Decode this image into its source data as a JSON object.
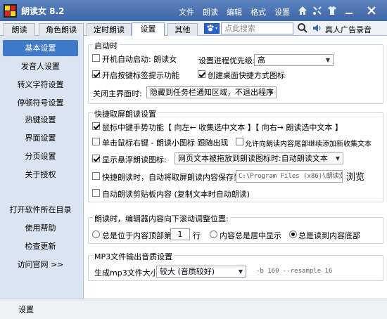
{
  "titlebar": {
    "title": "朗读女 8.2",
    "menu": [
      "文件",
      "朗读",
      "编辑",
      "格式",
      "设置"
    ],
    "icons": [
      "home-icon",
      "settings-gear-icon",
      "shirt-icon",
      "minimize-icon",
      "close-icon"
    ],
    "colors": {
      "bar": "#4a73b3",
      "logo_yellow": "#f7d21a",
      "logo_red": "#d8231f"
    }
  },
  "tabs": {
    "items": [
      "朗读",
      "角色朗读",
      "定时朗读",
      "设置",
      "其他"
    ],
    "active": "设置"
  },
  "search": {
    "placeholder": "点此搜索"
  },
  "ad_link": "真人广告录音",
  "sidebar": {
    "items": [
      "基本设置",
      "发音人设置",
      "转义字符设置",
      "停顿符号设置",
      "热键设置",
      "界面设置",
      "分页设置",
      "关于授权"
    ],
    "active": "基本设置",
    "links": [
      "打开软件所在目录",
      "使用帮助",
      "检查更新",
      "访问官网 >>"
    ]
  },
  "startup": {
    "title": "启动时",
    "auto_start_label": "开机自动启动: 朗读女",
    "auto_start_checked": false,
    "priority_label": "设置进程优先级:",
    "priority_value": "高",
    "hotkey_label": "开启按键标签提示功能",
    "hotkey_checked": true,
    "shortcut_label": "创建桌面快捷方式图标",
    "shortcut_checked": true,
    "close_label": "关闭主界面时:",
    "close_value": "隐藏到任务栏通知区域，不退出程序"
  },
  "screen_read": {
    "title": "快捷取屏朗读设置",
    "gesture_label": "鼠标中键手势功能【 向左← 收集选中文本 】【 向右→ 朗读选中文本 】",
    "gesture_checked": true,
    "rightclick_label": "单击鼠标右键 - 朗读小图标 跟随出现",
    "rightclick_checked": false,
    "append_label": "允许向朗读内容尾部继续添加新收集文本",
    "append_checked": false,
    "float_label": "显示悬浮朗读图标:",
    "float_checked": true,
    "float_value": "网页文本被拖放到朗读图标时:自动朗读文本",
    "quick_save_label": "快捷朗读时，自动将取屏朗读内容保存到:",
    "quick_save_checked": false,
    "quick_save_path": "C:\\Program Files (x86)\\朗读女\\",
    "browse_label": "浏览",
    "clipboard_label": "自动朗读剪贴板内容 (复制文本时自动朗读)",
    "clipboard_checked": false
  },
  "scroll": {
    "title": "朗读时，编辑器内容向下滚动调整位置:",
    "opt_top_prefix": "总是位于内容顶部第",
    "opt_top_value": "1",
    "opt_top_suffix": "行",
    "opt_center": "内容总是居中显示",
    "opt_bottom": "总是读到内容底部",
    "selected": "bottom"
  },
  "mp3": {
    "title": "MP3文件输出音质设置",
    "size_label": "生成mp3文件大小:",
    "size_value": "较大 (音质较好)",
    "params": "-b 160 --resample 16"
  },
  "status": {
    "text": "设置"
  }
}
